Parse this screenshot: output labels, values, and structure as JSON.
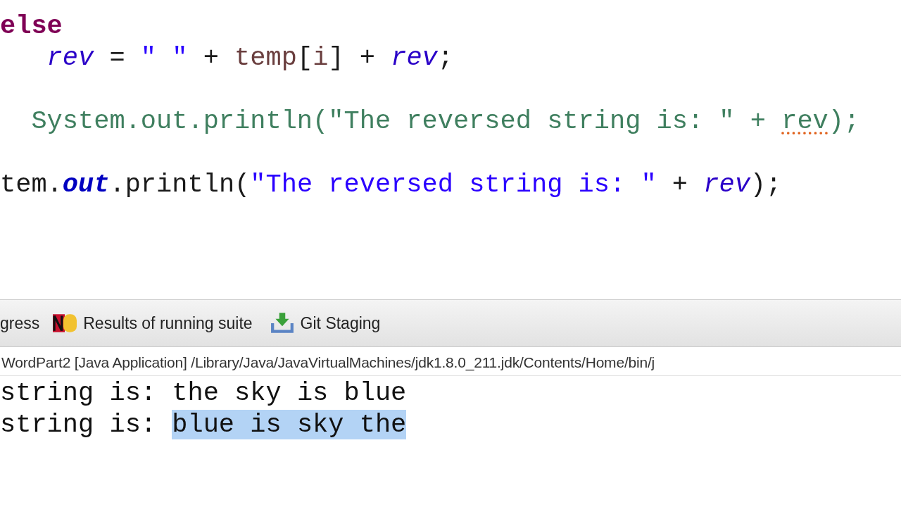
{
  "editor": {
    "lines": [
      {
        "tokens": [
          {
            "kind": "keyword",
            "text": "else"
          }
        ]
      },
      {
        "tokens": [
          {
            "kind": "field",
            "text": "   rev"
          },
          {
            "kind": "plain",
            "text": " = "
          },
          {
            "kind": "string",
            "text": "\" \""
          },
          {
            "kind": "plain",
            "text": " + "
          },
          {
            "kind": "local",
            "text": "temp"
          },
          {
            "kind": "plain",
            "text": "["
          },
          {
            "kind": "local",
            "text": "i"
          },
          {
            "kind": "plain",
            "text": "] + "
          },
          {
            "kind": "field",
            "text": "rev"
          },
          {
            "kind": "plain",
            "text": ";"
          }
        ]
      },
      {
        "tokens": [
          {
            "kind": "comment",
            "text": "  System.out.println(\"The reversed string is: \" + "
          },
          {
            "kind": "comment",
            "text": "rev",
            "misspelled": true
          },
          {
            "kind": "comment",
            "text": ");"
          }
        ]
      },
      {
        "tokens": [
          {
            "kind": "plain",
            "text": "tem."
          },
          {
            "kind": "static",
            "text": "out"
          },
          {
            "kind": "plain",
            "text": ".println("
          },
          {
            "kind": "string",
            "text": "\"The reversed string is: \""
          },
          {
            "kind": "plain",
            "text": " + "
          },
          {
            "kind": "field",
            "text": "rev"
          },
          {
            "kind": "plain",
            "text": ");"
          }
        ]
      }
    ]
  },
  "panel": {
    "tabs": [
      {
        "label": "gress",
        "selected": false
      },
      {
        "label": "Results of running suite",
        "selected": false
      },
      {
        "label": "Git Staging",
        "selected": false
      }
    ],
    "description": "WordPart2 [Java Application] /Library/Java/JavaVirtualMachines/jdk1.8.0_211.jdk/Contents/Home/bin/j",
    "output": [
      {
        "segments": [
          {
            "text": "string is: ",
            "selected": false
          },
          {
            "text": "the sky is blue",
            "selected": false
          }
        ]
      },
      {
        "segments": [
          {
            "text": "string is: ",
            "selected": false
          },
          {
            "text": "blue is sky the",
            "selected": true
          }
        ]
      }
    ]
  }
}
